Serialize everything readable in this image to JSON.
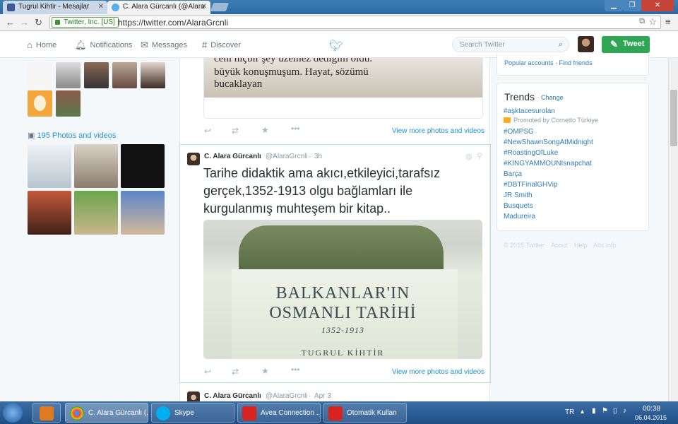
{
  "browser": {
    "tabs": [
      {
        "label": "Tugrul Kihtir - Mesajlar",
        "favicon": "facebook-icon"
      },
      {
        "label": "C. Alara Gürcanlı (@Alara",
        "favicon": "twitter-icon"
      }
    ],
    "ev_cert": "Twitter, Inc. [US]",
    "url": "https://twitter.com/AlaraGrcnli"
  },
  "nav": {
    "home": "Home",
    "notifications": "Notifications",
    "messages": "Messages",
    "discover": "Discover",
    "search_placeholder": "Search Twitter",
    "tweet_button": "Tweet"
  },
  "sidebar": {
    "photos_header": "195 Photos and videos"
  },
  "timeline": {
    "top_tweet": {
      "image_text_lines": [
        "ceni hiçbir şey üzemez dediğim oldu.",
        "büyük konuşmuşum. Hayat, sözümü",
        "bucaklayan"
      ],
      "view_more": "View more photos and videos"
    },
    "tweet": {
      "name": "C. Alara Gürcanlı",
      "handle": "@AlaraGrcnli",
      "time": "3h",
      "text": "Tarihe didaktik ama akıcı,etkileyici,tarafsız gerçek,1352-1913 olgu bağlamları ile kurgulanmış muhteşem bir kitap..",
      "book": {
        "title_line1": "BALKANLAR'IN",
        "title_line2": "OSMANLI TARİHİ",
        "years": "1352-1913",
        "author": "TUGRUL KİHTİR"
      },
      "view_more": "View more photos and videos"
    },
    "next_tweet": {
      "name": "C. Alara Gürcanlı",
      "handle": "@AlaraGrcnli",
      "time": "Apr 3"
    }
  },
  "right": {
    "top_links": "Popular accounts · Find friends",
    "trends_title": "Trends",
    "trends_change": "Change",
    "trends": [
      "#aşktacesurolan",
      "Promoted by Cornetto Türkiye",
      "#OMPSG",
      "#NewShawnSongAtMidnight",
      "#RoastingOfLuke",
      "#KINGYAMMOUNIsnapchat",
      "Barça",
      "#DBTFinalGHVip",
      "JR Smith",
      "Busquets",
      "Madureira"
    ],
    "footer": [
      "© 2015 Twitter",
      "About",
      "Help",
      "Ads info"
    ]
  },
  "taskbar": {
    "items": [
      {
        "label": "C. Alara Gürcanlı (..."
      },
      {
        "label": "Skype"
      },
      {
        "label": "Avea Connection ..."
      },
      {
        "label": "Otomatik Kullan"
      }
    ],
    "lang": "TR",
    "time": "00:38",
    "date": "06.04.2015"
  },
  "colors": {
    "twitter_blue": "#55acee",
    "link": "#2b7bb9",
    "tweet_green": "#2ea656"
  }
}
